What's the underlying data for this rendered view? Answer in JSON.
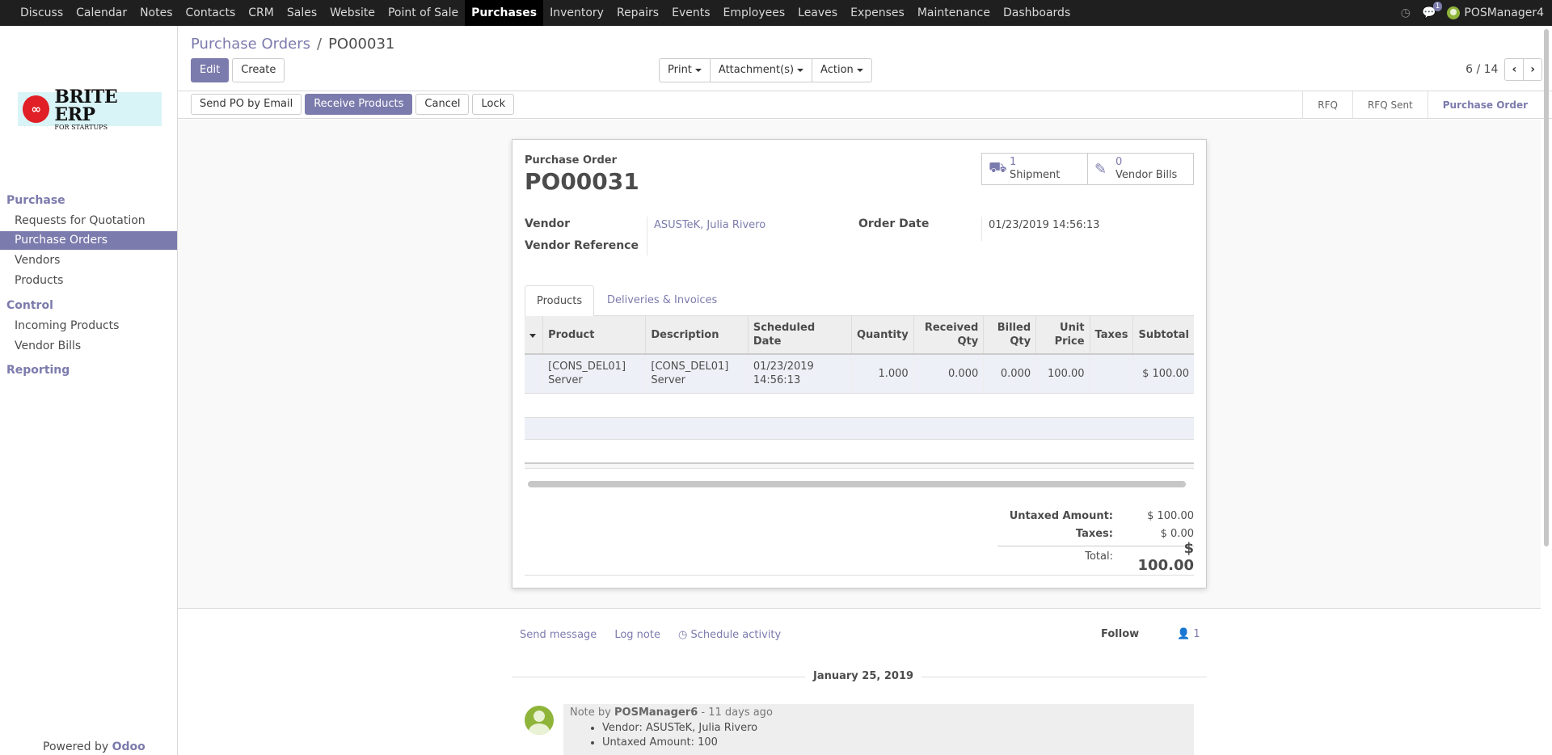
{
  "topbar": {
    "menu": [
      "Discuss",
      "Calendar",
      "Notes",
      "Contacts",
      "CRM",
      "Sales",
      "Website",
      "Point of Sale",
      "Purchases",
      "Inventory",
      "Repairs",
      "Events",
      "Employees",
      "Leaves",
      "Expenses",
      "Maintenance",
      "Dashboards"
    ],
    "active": "Purchases",
    "messages_badge": "1",
    "user": "POSManager4"
  },
  "sidebar": {
    "logo_text": "BRITE ERP",
    "logo_sub": "FOR STARTUPS",
    "sections": [
      {
        "title": "Purchase",
        "items": [
          "Requests for Quotation",
          "Purchase Orders",
          "Vendors",
          "Products"
        ]
      },
      {
        "title": "Control",
        "items": [
          "Incoming Products",
          "Vendor Bills"
        ]
      },
      {
        "title": "Reporting",
        "items": []
      }
    ],
    "active_item": "Purchase Orders",
    "powered_by": "Powered by",
    "powered_brand": "Odoo"
  },
  "breadcrumb": {
    "parent": "Purchase Orders",
    "separator": "/",
    "current": "PO00031"
  },
  "buttons": {
    "edit": "Edit",
    "create": "Create",
    "print": "Print",
    "attachments": "Attachment(s)",
    "action": "Action",
    "send_po": "Send PO by Email",
    "receive": "Receive Products",
    "cancel": "Cancel",
    "lock": "Lock"
  },
  "pager": {
    "value": "6 / 14"
  },
  "status": {
    "steps": [
      "RFQ",
      "RFQ Sent",
      "Purchase Order"
    ],
    "current": "Purchase Order"
  },
  "form": {
    "caption": "Purchase Order",
    "name": "PO00031",
    "smart_buttons": [
      {
        "count": "1",
        "label": "Shipment",
        "icon": "truck-icon"
      },
      {
        "count": "0",
        "label": "Vendor Bills",
        "icon": "edit-icon"
      }
    ],
    "vendor_label": "Vendor",
    "vendor_value": "ASUSTeK, Julia Rivero",
    "vendor_ref_label": "Vendor Reference",
    "order_date_label": "Order Date",
    "order_date_value": "01/23/2019 14:56:13",
    "tabs": [
      "Products",
      "Deliveries & Invoices"
    ],
    "active_tab": "Products"
  },
  "lines": {
    "headers": [
      "Product",
      "Description",
      "Scheduled Date",
      "Quantity",
      "Received Qty",
      "Billed Qty",
      "Unit Price",
      "Taxes",
      "Subtotal"
    ],
    "rows": [
      {
        "product": "[CONS_DEL01] Server",
        "description": "[CONS_DEL01] Server",
        "scheduled": "01/23/2019 14:56:13",
        "quantity": "1.000",
        "received": "0.000",
        "billed": "0.000",
        "unit_price": "100.00",
        "taxes": "",
        "subtotal": "$ 100.00"
      }
    ]
  },
  "totals": {
    "untaxed_label": "Untaxed Amount:",
    "untaxed": "$ 100.00",
    "taxes_label": "Taxes:",
    "taxes": "$ 0.00",
    "total_label": "Total:",
    "total": "$ 100.00"
  },
  "chatter": {
    "send_message": "Send message",
    "log_note": "Log note",
    "schedule_activity": "Schedule activity",
    "follow": "Follow",
    "followers_count": "1",
    "date": "January 25, 2019",
    "message": {
      "prefix": "Note by",
      "author": "POSManager6",
      "when": "- 11 days ago",
      "items": [
        "Vendor: ASUSTeK, Julia Rivero",
        "Untaxed Amount: 100"
      ]
    }
  }
}
